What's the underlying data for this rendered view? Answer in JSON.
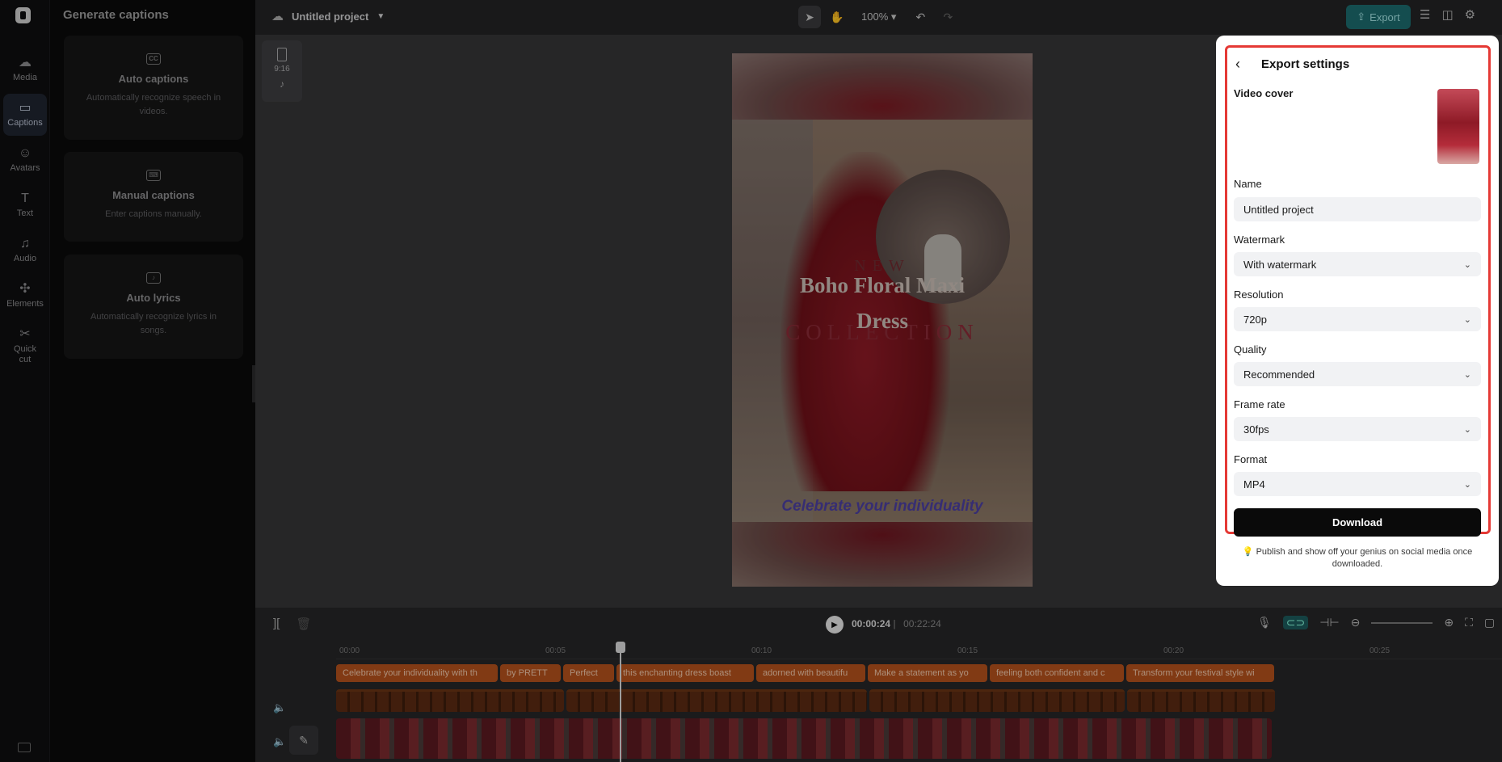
{
  "rail": {
    "items": [
      {
        "label": "Media",
        "icon": "media-icon"
      },
      {
        "label": "Captions",
        "icon": "captions-icon"
      },
      {
        "label": "Avatars",
        "icon": "avatars-icon"
      },
      {
        "label": "Text",
        "icon": "text-icon"
      },
      {
        "label": "Audio",
        "icon": "audio-icon"
      },
      {
        "label": "Elements",
        "icon": "elements-icon"
      },
      {
        "label": "Quick cut",
        "icon": "quick-cut-icon"
      }
    ],
    "active": "Captions"
  },
  "side_panel": {
    "title": "Generate captions",
    "cards": [
      {
        "title": "Auto captions",
        "desc": "Automatically recognize speech in videos."
      },
      {
        "title": "Manual captions",
        "desc": "Enter captions manually."
      },
      {
        "title": "Auto lyrics",
        "desc": "Automatically recognize lyrics in songs."
      }
    ]
  },
  "topbar": {
    "project_title": "Untitled project",
    "zoom": "100%",
    "export_label": "Export"
  },
  "ratio": {
    "label": "9:16"
  },
  "video": {
    "new": "NEW",
    "line1": "Boho Floral Maxi",
    "line2": "Dress",
    "collection": "COLLECTION",
    "caption": "Celebrate your individuality"
  },
  "timeline": {
    "current_time": "00:00:24",
    "total_time": "00:22:24",
    "ticks": [
      "00:00",
      "00:05",
      "00:10",
      "00:15",
      "00:20",
      "00:25"
    ],
    "captions": [
      "Celebrate your individuality with th",
      "by PRETT",
      "Perfect",
      "this enchanting dress boast",
      "adorned with beautifu",
      "Make a statement as yo",
      "feeling both confident and c",
      "Transform your festival style wi"
    ]
  },
  "export": {
    "title": "Export settings",
    "video_cover_label": "Video cover",
    "name_label": "Name",
    "name_value": "Untitled project",
    "watermark_label": "Watermark",
    "watermark_value": "With watermark",
    "resolution_label": "Resolution",
    "resolution_value": "720p",
    "quality_label": "Quality",
    "quality_value": "Recommended",
    "framerate_label": "Frame rate",
    "framerate_value": "30fps",
    "format_label": "Format",
    "format_value": "MP4",
    "download_label": "Download",
    "hint": "Publish and show off your genius on social media once downloaded."
  },
  "colors": {
    "accent": "#1d6b6e",
    "highlight_border": "#e53935",
    "caption_clip": "#b3511c"
  }
}
